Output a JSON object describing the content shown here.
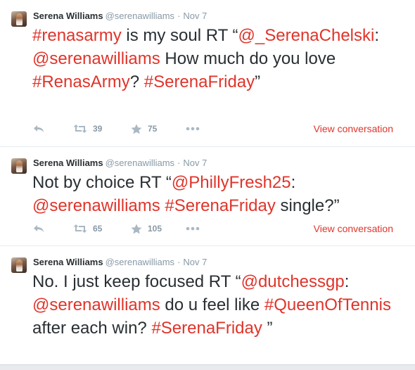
{
  "colors": {
    "link": "#e0342a",
    "muted": "#8899a6",
    "text": "#292f33"
  },
  "tweets": [
    {
      "name": "Serena Williams",
      "handle": "@serenawilliams",
      "dot": "·",
      "date": "Nov 7",
      "text": [
        {
          "t": "#renasarmy",
          "link": true
        },
        {
          "t": " is my soul RT “",
          "link": false
        },
        {
          "t": "@_SerenaChelski",
          "link": true
        },
        {
          "t": ": ",
          "link": false
        },
        {
          "t": "@serenawilliams",
          "link": true
        },
        {
          "t": " How much do you love ",
          "link": false
        },
        {
          "t": "#RenasArmy",
          "link": true
        },
        {
          "t": "? ",
          "link": false
        },
        {
          "t": "#SerenaFriday",
          "link": true
        },
        {
          "t": "”",
          "link": false
        }
      ],
      "retweets": "39",
      "favorites": "75",
      "more": "•••",
      "view_conversation": "View conversation"
    },
    {
      "name": "Serena Williams",
      "handle": "@serenawilliams",
      "dot": "·",
      "date": "Nov 7",
      "text": [
        {
          "t": "Not by choice RT “",
          "link": false
        },
        {
          "t": "@PhillyFresh25",
          "link": true
        },
        {
          "t": ": ",
          "link": false
        },
        {
          "t": "@serenawilliams",
          "link": true
        },
        {
          "t": " ",
          "link": false
        },
        {
          "t": "#SerenaFriday",
          "link": true
        },
        {
          "t": " single?”",
          "link": false
        }
      ],
      "retweets": "65",
      "favorites": "105",
      "more": "•••",
      "view_conversation": "View conversation"
    },
    {
      "name": "Serena Williams",
      "handle": "@serenawilliams",
      "dot": "·",
      "date": "Nov 7",
      "text": [
        {
          "t": "No. I just keep focused RT “",
          "link": false
        },
        {
          "t": "@dutchessgp",
          "link": true
        },
        {
          "t": ": ",
          "link": false
        },
        {
          "t": "@serenawilliams",
          "link": true
        },
        {
          "t": " do u feel like ",
          "link": false
        },
        {
          "t": "#QueenOfTennis",
          "link": true
        },
        {
          "t": " after each win? ",
          "link": false
        },
        {
          "t": "#SerenaFriday",
          "link": true
        },
        {
          "t": " ”",
          "link": false
        }
      ]
    }
  ],
  "icons": {
    "reply": "reply-icon",
    "retweet": "retweet-icon",
    "favorite": "star-icon",
    "more": "more-icon"
  }
}
